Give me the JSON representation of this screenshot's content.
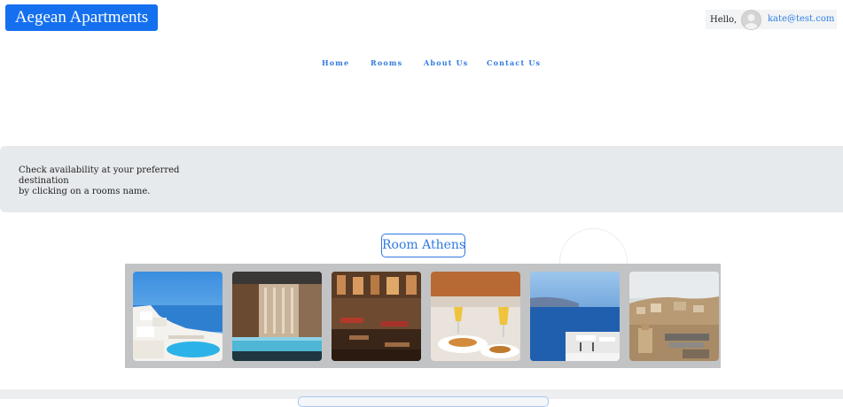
{
  "header": {
    "brand": "Aegean Apartments",
    "greeting": "Hello,",
    "user_email": "kate@test.com"
  },
  "nav": {
    "items": [
      "Home",
      "Rooms",
      "About Us",
      "Contact Us"
    ]
  },
  "banner": {
    "text_line1": "Check availability at your preferred destination",
    "text_line2": "by clicking on a rooms name."
  },
  "room": {
    "title": "Room Athens"
  },
  "gallery": {
    "photos": [
      "santorini-pool-photo",
      "indoor-pool-photo",
      "restaurant-interior-photo",
      "breakfast-table-photo",
      "sea-view-terrace-photo",
      "athens-city-view-photo"
    ]
  },
  "colors": {
    "accent": "#1570ef",
    "link": "#2f7ae0",
    "banner_bg": "#e7eaed",
    "gallery_bg": "#c2c3c4"
  }
}
